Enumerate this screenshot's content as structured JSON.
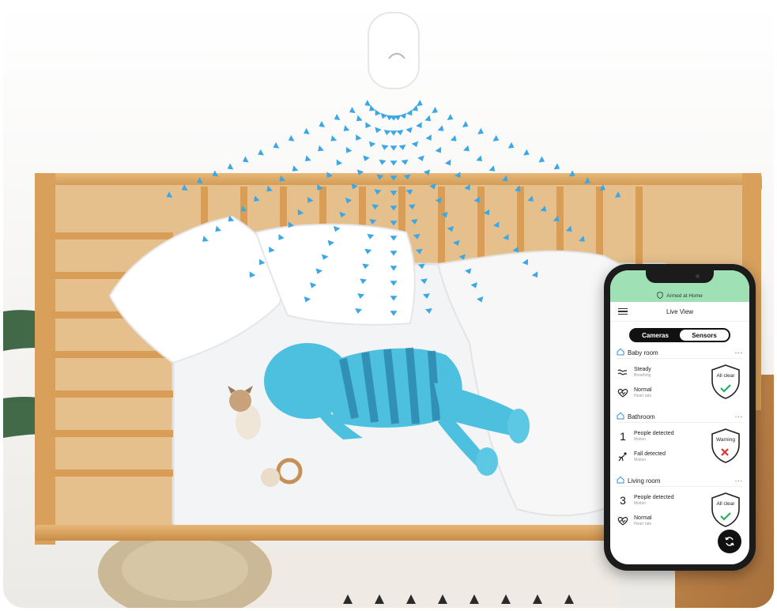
{
  "phone": {
    "status_text": "Armed at Home",
    "nav_title": "Live View",
    "tabs": {
      "cameras": "Cameras",
      "sensors": "Sensors"
    },
    "rooms": [
      {
        "name": "Baby room",
        "rows": [
          {
            "kind": "icon",
            "icon": "breathing-wave-icon",
            "title": "Steady",
            "subtitle": "Breathing"
          },
          {
            "kind": "icon",
            "icon": "heart-rate-icon",
            "title": "Normal",
            "subtitle": "Heart rate"
          }
        ],
        "badge": {
          "label": "All clear",
          "status": "ok",
          "color": "#22b35a"
        }
      },
      {
        "name": "Bathroom",
        "rows": [
          {
            "kind": "number",
            "value": "1",
            "title": "People detected",
            "subtitle": "Motion"
          },
          {
            "kind": "icon",
            "icon": "fall-person-icon",
            "title": "Fall detected",
            "subtitle": "Motion"
          }
        ],
        "badge": {
          "label": "Warning",
          "status": "alert",
          "color": "#e0342f"
        }
      },
      {
        "name": "Living room",
        "rows": [
          {
            "kind": "number",
            "value": "3",
            "title": "People detected",
            "subtitle": "Motion"
          },
          {
            "kind": "icon",
            "icon": "heart-rate-icon",
            "title": "Normal",
            "subtitle": "Heart rate"
          }
        ],
        "badge": {
          "label": "All clear",
          "status": "ok",
          "color": "#22b35a"
        }
      }
    ]
  },
  "colors": {
    "sensor_signal": "#3aa7e6",
    "baby_overlay": "#4cc0de",
    "header_green": "#9fe0b4",
    "crib_wood": "#d9a25c"
  }
}
